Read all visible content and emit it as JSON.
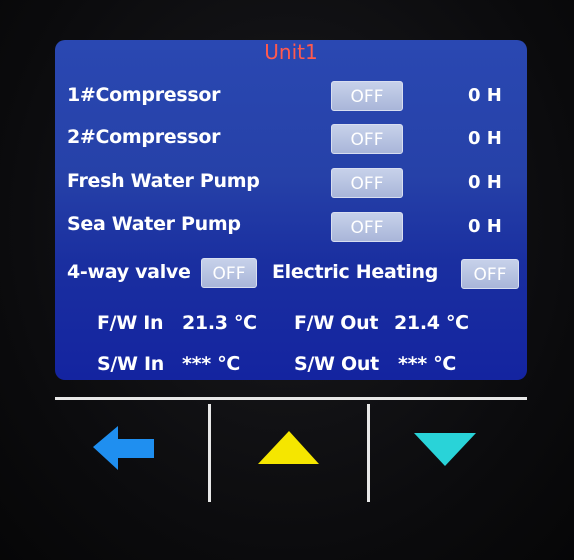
{
  "unit_title": "Unit1",
  "rows": [
    {
      "label": "1#Compressor",
      "state": "OFF",
      "hours": "0 H"
    },
    {
      "label": "2#Compressor",
      "state": "OFF",
      "hours": "0 H"
    },
    {
      "label": "Fresh Water Pump",
      "state": "OFF",
      "hours": "0 H"
    },
    {
      "label": "Sea Water Pump",
      "state": "OFF",
      "hours": "0 H"
    }
  ],
  "valve": {
    "label": "4-way valve",
    "state": "OFF"
  },
  "heating": {
    "label": "Electric Heating",
    "state": "OFF"
  },
  "temps": {
    "fw_in_label": "F/W In",
    "fw_in_value": "21.3 ℃",
    "fw_out_label": "F/W Out",
    "fw_out_value": "21.4 ℃",
    "sw_in_label": "S/W In",
    "sw_in_value": "*** ℃",
    "sw_out_label": "S/W Out",
    "sw_out_value": "*** ℃"
  },
  "keys": {
    "back": {
      "icon": "left-arrow-icon",
      "color": "#1f8ff0"
    },
    "up": {
      "icon": "up-triangle-icon",
      "color": "#f5e600"
    },
    "down": {
      "icon": "down-triangle-icon",
      "color": "#29d3d8"
    }
  }
}
